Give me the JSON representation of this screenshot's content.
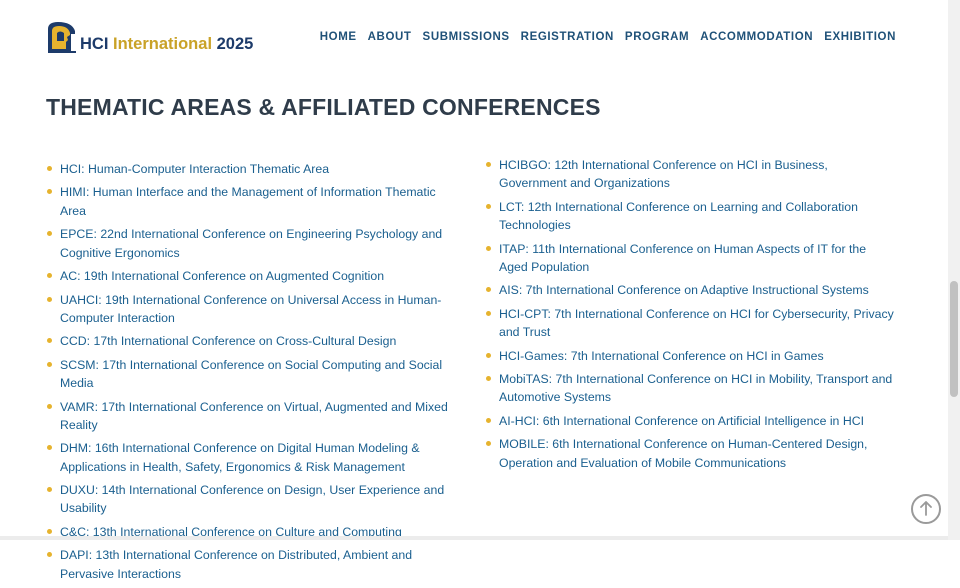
{
  "logo": {
    "hci": "HCI",
    "international": "International",
    "year": "2025"
  },
  "nav": [
    {
      "label": "HOME"
    },
    {
      "label": "ABOUT"
    },
    {
      "label": "SUBMISSIONS"
    },
    {
      "label": "REGISTRATION"
    },
    {
      "label": "PROGRAM"
    },
    {
      "label": "ACCOMMODATION"
    },
    {
      "label": "EXHIBITION"
    }
  ],
  "section_title": "THEMATIC AREAS & AFFILIATED CONFERENCES",
  "left_items": [
    {
      "label": "HCI: Human-Computer Interaction Thematic Area"
    },
    {
      "label": "HIMI: Human Interface and the Management of Information Thematic Area"
    },
    {
      "label": "EPCE: 22nd International Conference on Engineering Psychology and Cognitive Ergonomics"
    },
    {
      "label": "AC: 19th International Conference on Augmented Cognition"
    },
    {
      "label": "UAHCI: 19th International Conference on Universal Access in Human-Computer Interaction"
    },
    {
      "label": "CCD: 17th International Conference on Cross-Cultural Design"
    },
    {
      "label": "SCSM: 17th International Conference on Social Computing and Social Media"
    },
    {
      "label": "VAMR: 17th International Conference on Virtual, Augmented and Mixed Reality"
    },
    {
      "label": "DHM: 16th International Conference on Digital Human Modeling & Applications in Health, Safety, Ergonomics & Risk Management"
    },
    {
      "label": "DUXU: 14th International Conference on Design, User Experience and Usability"
    },
    {
      "label": "C&C: 13th International Conference on Culture and Computing"
    },
    {
      "label": "DAPI: 13th International Conference on Distributed, Ambient and Pervasive Interactions"
    }
  ],
  "right_items": [
    {
      "label": "HCIBGO: 12th International Conference on HCI in Business, Government and Organizations"
    },
    {
      "label": "LCT: 12th International Conference on Learning and Collaboration Technologies"
    },
    {
      "label": "ITAP: 11th International Conference on Human Aspects of IT for the Aged Population"
    },
    {
      "label": "AIS: 7th International Conference on Adaptive Instructional Systems"
    },
    {
      "label": "HCI-CPT: 7th International Conference on HCI for Cybersecurity, Privacy and Trust"
    },
    {
      "label": "HCI-Games: 7th International Conference on HCI in Games"
    },
    {
      "label": "MobiTAS: 7th International Conference on HCI in Mobility, Transport and Automotive Systems"
    },
    {
      "label": "AI-HCI: 6th International Conference on Artificial Intelligence in HCI"
    },
    {
      "label": "MOBILE: 6th International Conference on Human-Centered Design, Operation and Evaluation of Mobile Communications"
    }
  ],
  "colors": {
    "link": "#1a5f8f",
    "bullet": "#e6b32e",
    "nav": "#1f5178",
    "heading": "#2f3c4a",
    "brand_gold": "#c9a227",
    "brand_navy": "#1d3b6a"
  },
  "icons": {
    "logo": "hci-profile-logo-icon",
    "back_to_top": "arrow-up-circle-icon"
  }
}
